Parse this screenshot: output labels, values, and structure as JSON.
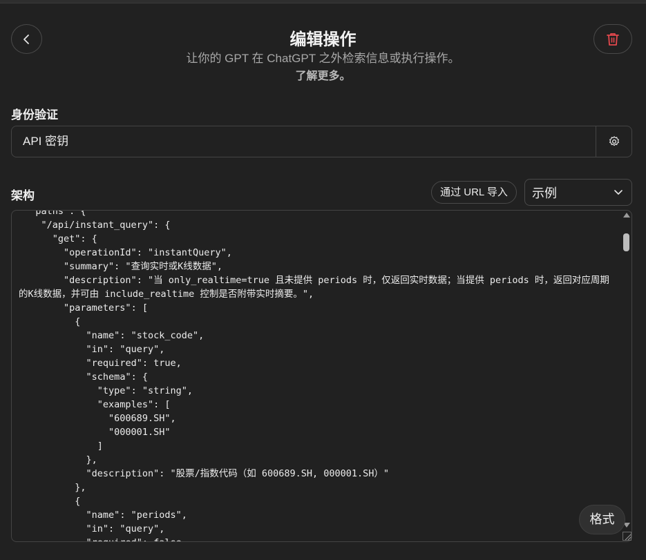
{
  "header": {
    "title": "编辑操作",
    "subtitle": "让你的 GPT 在 ChatGPT 之外检索信息或执行操作。",
    "learn_more": "了解更多。"
  },
  "authentication": {
    "label": "身份验证",
    "value": "API 密钥"
  },
  "schema": {
    "label": "架构",
    "import_button": "通过 URL 导入",
    "example_select": "示例",
    "format_button": "格式",
    "code": "  \"paths\": {\n    \"/api/instant_query\": {\n      \"get\": {\n        \"operationId\": \"instantQuery\",\n        \"summary\": \"查询实时或K线数据\",\n        \"description\": \"当 only_realtime=true 且未提供 periods 时，仅返回实时数据；当提供 periods 时，返回对应周期的K线数据，并可由 include_realtime 控制是否附带实时摘要。\",\n        \"parameters\": [\n          {\n            \"name\": \"stock_code\",\n            \"in\": \"query\",\n            \"required\": true,\n            \"schema\": {\n              \"type\": \"string\",\n              \"examples\": [\n                \"600689.SH\",\n                \"000001.SH\"\n              ]\n            },\n            \"description\": \"股票/指数代码（如 600689.SH, 000001.SH）\"\n          },\n          {\n            \"name\": \"periods\",\n            \"in\": \"query\",\n            \"required\": false,"
  },
  "colors": {
    "background": "#212121",
    "delete_icon": "#e5484d",
    "border": "#444444"
  },
  "icons": {
    "back": "chevron-left-icon",
    "delete": "trash-icon",
    "settings": "gear-icon",
    "dropdown": "chevron-down-icon"
  }
}
